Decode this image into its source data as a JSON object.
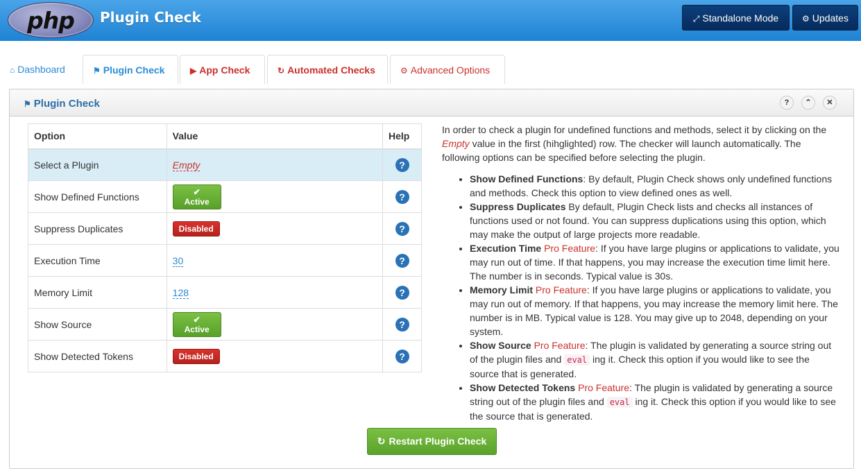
{
  "header": {
    "logo_text": "php",
    "title": "Plugin Check",
    "standalone_label": "Standalone Mode",
    "updates_label": "Updates"
  },
  "tabs": [
    {
      "label": "Dashboard"
    },
    {
      "label": "Plugin Check"
    },
    {
      "label": "App Check"
    },
    {
      "label": "Automated Checks"
    },
    {
      "label": "Advanced Options"
    }
  ],
  "panel": {
    "title": "Plugin Check"
  },
  "table": {
    "headers": [
      "Option",
      "Value",
      "Help"
    ],
    "rows": [
      {
        "option": "Select a Plugin",
        "value": "Empty"
      },
      {
        "option": "Show Defined Functions",
        "value": "Active"
      },
      {
        "option": "Suppress Duplicates",
        "value": "Disabled"
      },
      {
        "option": "Execution Time",
        "value": "30"
      },
      {
        "option": "Memory Limit",
        "value": "128"
      },
      {
        "option": "Show Source",
        "value": "Active"
      },
      {
        "option": "Show Detected Tokens",
        "value": "Disabled"
      }
    ]
  },
  "description": {
    "intro_1": "In order to check a plugin for undefined functions and methods, select it by clicking on the",
    "intro_empty": "Empty",
    "intro_2": "value in the first (hihglighted) row. The checker will launch automatically. The following options can be specified before selecting the plugin.",
    "pro_feature": "Pro Feature",
    "eval": "eval",
    "items": [
      {
        "title": "Show Defined Functions",
        "text": ": By default, Plugin Check shows only undefined functions and methods. Check this option to view defined ones as well."
      },
      {
        "title": "Suppress Duplicates",
        "text": "By default, Plugin Check lists and checks all instances of functions used or not found. You can suppress duplications using this option, which may make the output of large projects more readable."
      },
      {
        "title": "Execution Time",
        "text": ": If you have large plugins or applications to validate, you may run out of time. If that happens, you may increase the execution time limit here. The number is in seconds. Typical value is 30s."
      },
      {
        "title": "Memory Limit",
        "text": ": If you have large plugins or applications to validate, you may run out of memory. If that happens, you may increase the memory limit here. The number is in MB. Typical value is 128. You may give up to 2048, depending on your system."
      },
      {
        "title": "Show Source",
        "text_a": ": The plugin is validated by generating a source string out of the plugin files and",
        "text_b": "ing it. Check this option if you would like to see the source that is generated."
      },
      {
        "title": "Show Detected Tokens",
        "text_a": ": The plugin is validated by generating a source string out of the plugin files and",
        "text_b": "ing it. Check this option if you would like to see the source that is generated."
      }
    ]
  },
  "restart_label": "Restart Plugin Check",
  "colors": {
    "header_blue": "#1e83d4",
    "active_green": "#57a02a",
    "disabled_red": "#b5221d",
    "link_blue": "#2a8bd5",
    "accent_red": "#c9302c"
  }
}
